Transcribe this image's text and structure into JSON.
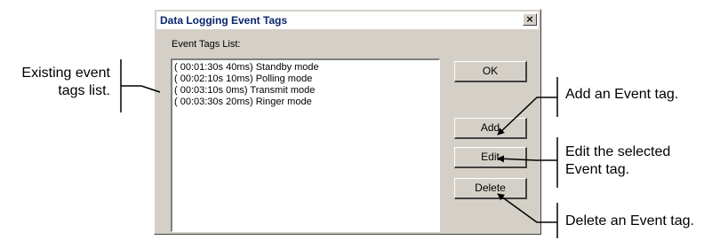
{
  "dialog": {
    "title": "Data Logging Event Tags",
    "close_label": "×",
    "list_label": "Event Tags List:",
    "list_items": [
      "( 00:01:30s 40ms) Standby mode",
      "( 00:02:10s 10ms) Polling mode",
      "( 00:03:10s 0ms) Transmit mode",
      "( 00:03:30s 20ms) Ringer mode"
    ],
    "buttons": {
      "ok": "OK",
      "add": "Add",
      "edit": "Edit",
      "delete": "Delete"
    }
  },
  "annotations": {
    "left": "Existing event tags list.",
    "add": "Add an Event tag.",
    "edit": "Edit the selected Event tag.",
    "delete": "Delete an Event tag."
  }
}
